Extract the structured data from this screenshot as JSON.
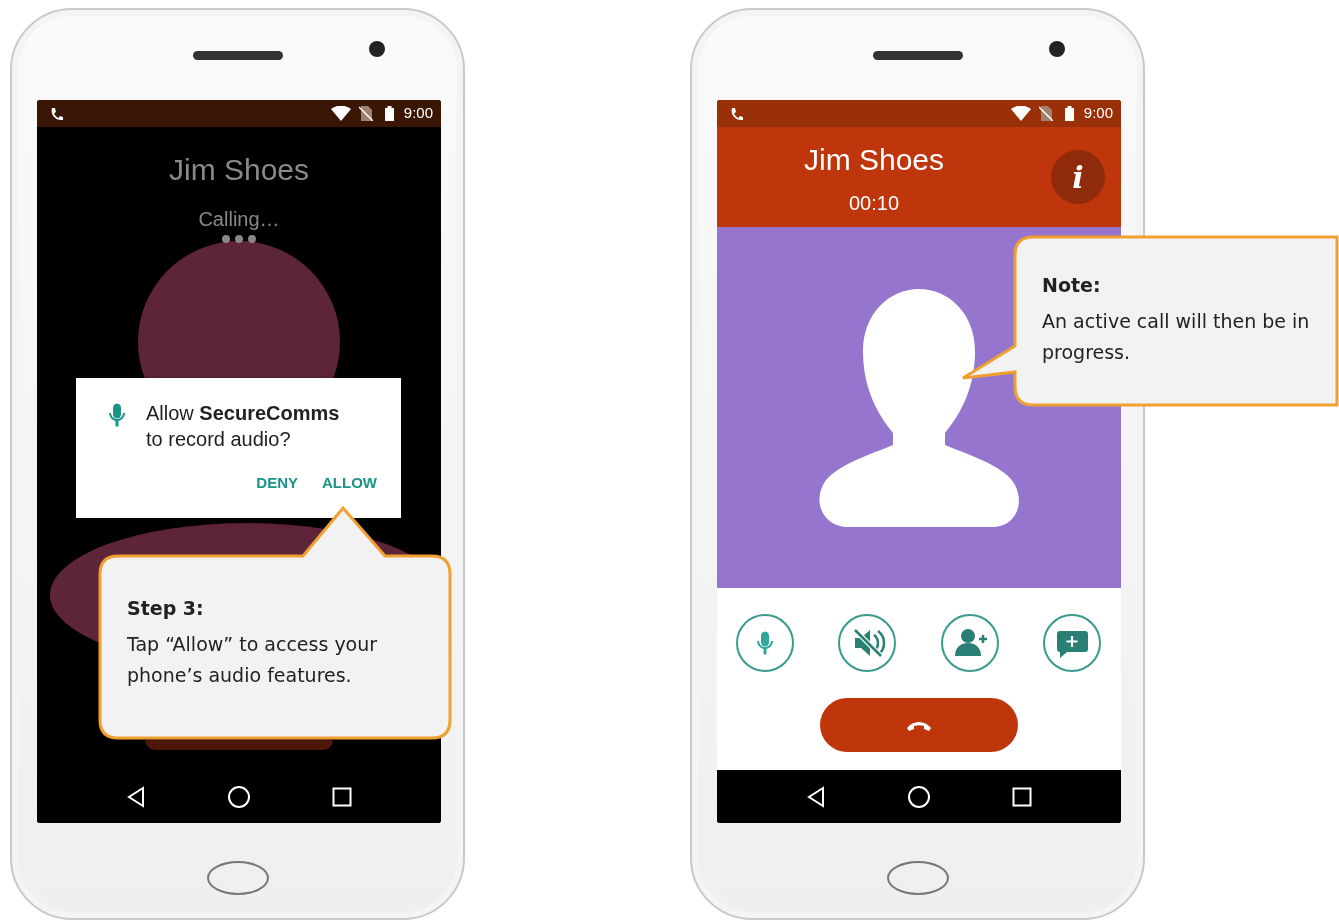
{
  "phones": [
    {
      "kind": "calling",
      "status_bar": {
        "time": "9:00"
      },
      "contact": "Jim Shoes",
      "status": "Calling…",
      "dialog": {
        "message": "Allow **SecureComms** to record audio?",
        "buttons": [
          "DENY",
          "ALLOW"
        ]
      }
    },
    {
      "kind": "active",
      "status_bar": {
        "time": "9:00"
      },
      "contact": "Jim Shoes",
      "timer": "00:10",
      "info_button": "i"
    }
  ],
  "callouts": [
    {
      "title": "Step 3:",
      "text": "Tap “Allow” to access your phone’s audio features."
    },
    {
      "title": "Note:",
      "text": "An active call will then be in progress."
    }
  ]
}
